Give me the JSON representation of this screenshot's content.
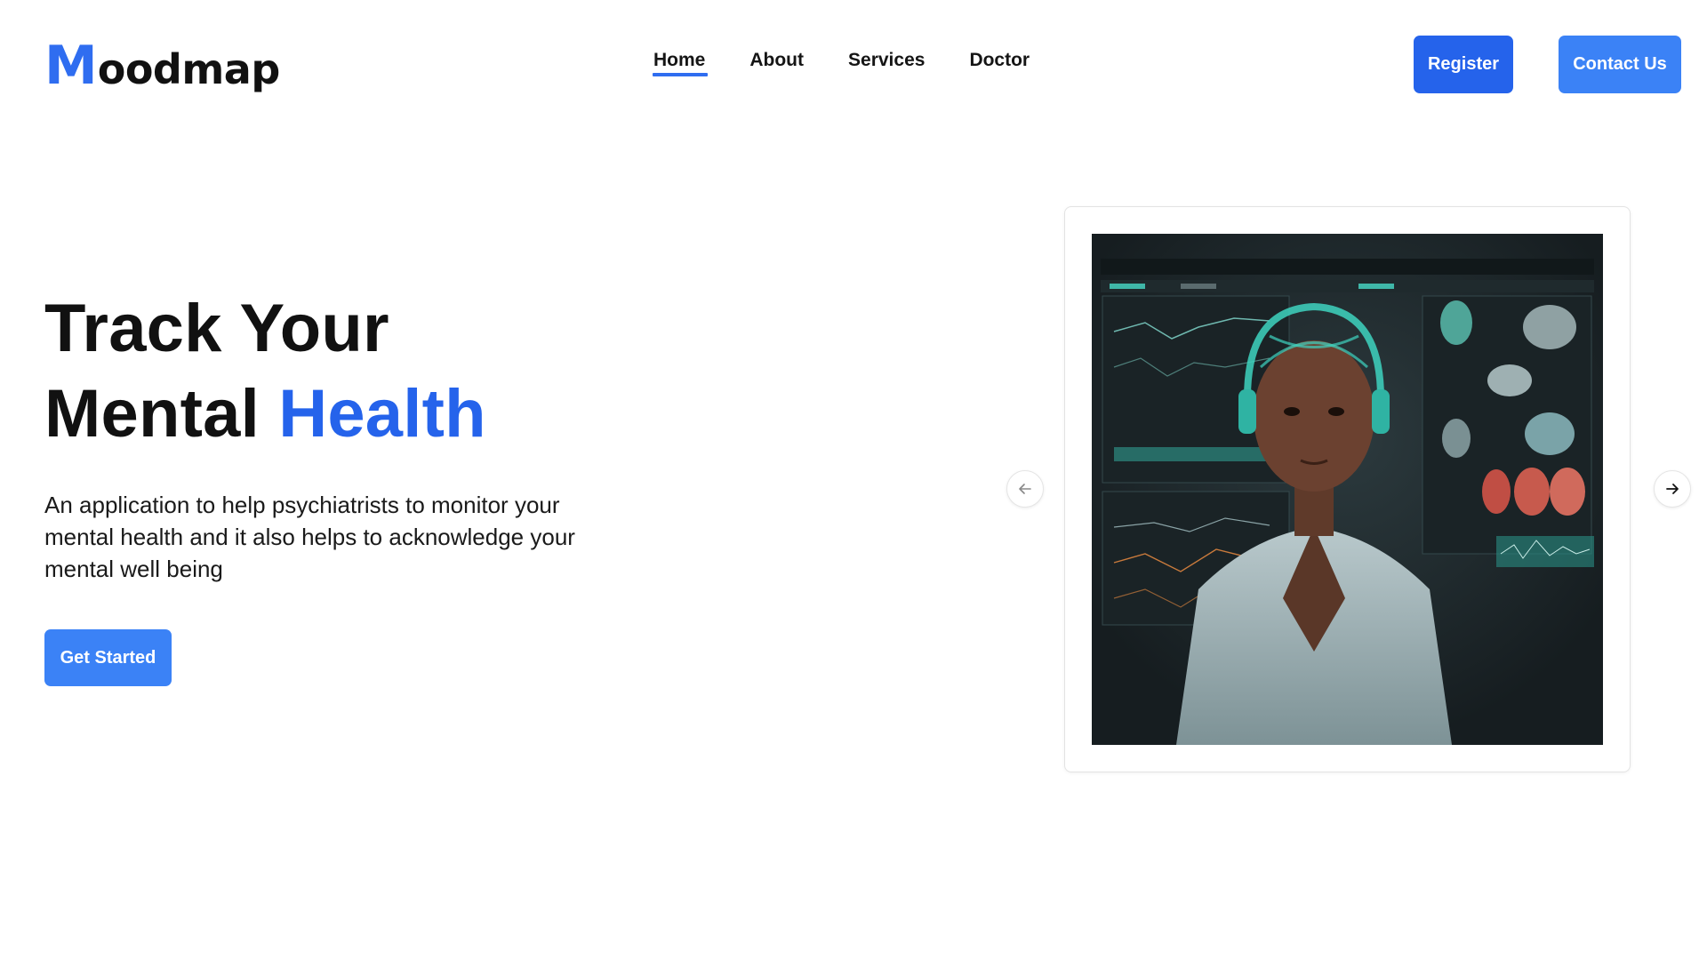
{
  "brand": {
    "logo_initial": "M",
    "logo_rest": "oodmap",
    "accent_color": "#2563eb"
  },
  "nav": {
    "items": [
      {
        "label": "Home",
        "active": true
      },
      {
        "label": "About",
        "active": false
      },
      {
        "label": "Services",
        "active": false
      },
      {
        "label": "Doctor",
        "active": false
      }
    ]
  },
  "header_buttons": {
    "register": "Register",
    "contact": "Contact Us"
  },
  "hero": {
    "title_line1": "Track Your",
    "title_line2_plain": "Mental",
    "title_line2_accent": "Health",
    "description": "An application to help psychiatrists to monitor your mental health and it also helps to acknowledge your mental well being",
    "cta": "Get Started"
  },
  "carousel": {
    "prev_icon": "arrow-left-icon",
    "next_icon": "arrow-right-icon"
  }
}
